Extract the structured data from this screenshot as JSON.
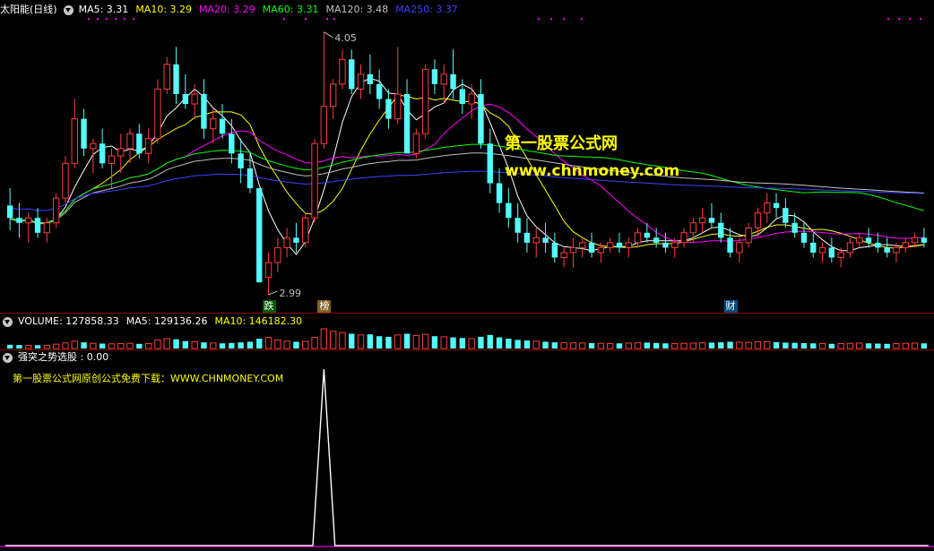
{
  "header_main": {
    "name": "太阳能(日线)",
    "ma5": "MA5: 3.31",
    "ma10": "MA10: 3.29",
    "ma20": "MA20: 3.29",
    "ma60": "MA60: 3.31",
    "ma120": "MA120: 3.48",
    "ma250": "MA250: 3.37"
  },
  "header_volume": {
    "volume": "VOLUME: 127858.33",
    "ma5": "MA5: 129136.26",
    "ma10": "MA10: 146182.30"
  },
  "header_indicator": {
    "name": "强突之势选股 : 0.00"
  },
  "watermark": {
    "line1": "第一股票公式网",
    "line2": "www.chnmoney.com"
  },
  "indicator_note": "第一股票公式网原创公式免费下载：WWW.CHNMONEY.COM",
  "price_labels": {
    "high": "4.05",
    "low": "2.99"
  },
  "signals": [
    {
      "text": "跌",
      "color": "#005a00",
      "index": 28
    },
    {
      "text": "榜",
      "color": "#806020",
      "index": 34
    },
    {
      "text": "财",
      "color": "#004a80",
      "index": 78
    }
  ],
  "colors": {
    "up": "#ff3c3c",
    "down": "#54fcfc",
    "ma5": "#ffffff",
    "ma10": "#ffff00",
    "ma20": "#ff00ff",
    "ma60": "#00ff00",
    "ma120": "#c0c0c0",
    "ma250": "#4040ff"
  },
  "chart_data": {
    "type": "candlestick",
    "price_range": [
      2.95,
      4.1
    ],
    "ohlc": [
      [
        3.35,
        3.42,
        3.25,
        3.3
      ],
      [
        3.3,
        3.36,
        3.22,
        3.28
      ],
      [
        3.28,
        3.32,
        3.2,
        3.3
      ],
      [
        3.3,
        3.34,
        3.22,
        3.24
      ],
      [
        3.24,
        3.3,
        3.2,
        3.28
      ],
      [
        3.28,
        3.4,
        3.26,
        3.38
      ],
      [
        3.38,
        3.55,
        3.36,
        3.52
      ],
      [
        3.52,
        3.78,
        3.5,
        3.7
      ],
      [
        3.7,
        3.74,
        3.55,
        3.58
      ],
      [
        3.58,
        3.62,
        3.48,
        3.6
      ],
      [
        3.6,
        3.66,
        3.5,
        3.52
      ],
      [
        3.52,
        3.58,
        3.42,
        3.55
      ],
      [
        3.55,
        3.64,
        3.48,
        3.58
      ],
      [
        3.58,
        3.66,
        3.52,
        3.64
      ],
      [
        3.64,
        3.68,
        3.54,
        3.56
      ],
      [
        3.56,
        3.66,
        3.52,
        3.62
      ],
      [
        3.62,
        3.86,
        3.6,
        3.82
      ],
      [
        3.82,
        3.95,
        3.8,
        3.92
      ],
      [
        3.92,
        3.99,
        3.76,
        3.8
      ],
      [
        3.8,
        3.88,
        3.74,
        3.76
      ],
      [
        3.76,
        3.84,
        3.7,
        3.8
      ],
      [
        3.8,
        3.86,
        3.62,
        3.66
      ],
      [
        3.66,
        3.74,
        3.6,
        3.7
      ],
      [
        3.7,
        3.76,
        3.62,
        3.64
      ],
      [
        3.64,
        3.7,
        3.52,
        3.56
      ],
      [
        3.56,
        3.62,
        3.44,
        3.5
      ],
      [
        3.5,
        3.56,
        3.4,
        3.42
      ],
      [
        3.42,
        3.42,
        3.05,
        3.04
      ],
      [
        3.06,
        3.16,
        2.99,
        3.12
      ],
      [
        3.12,
        3.22,
        3.08,
        3.18
      ],
      [
        3.18,
        3.26,
        3.14,
        3.22
      ],
      [
        3.22,
        3.28,
        3.16,
        3.2
      ],
      [
        3.2,
        3.32,
        3.18,
        3.3
      ],
      [
        3.3,
        3.62,
        3.28,
        3.6
      ],
      [
        3.6,
        4.05,
        3.58,
        3.75
      ],
      [
        3.75,
        3.86,
        3.7,
        3.84
      ],
      [
        3.84,
        3.98,
        3.82,
        3.94
      ],
      [
        3.94,
        3.98,
        3.8,
        3.82
      ],
      [
        3.82,
        3.92,
        3.78,
        3.88
      ],
      [
        3.88,
        3.96,
        3.8,
        3.84
      ],
      [
        3.84,
        3.9,
        3.74,
        3.78
      ],
      [
        3.78,
        3.82,
        3.66,
        3.7
      ],
      [
        3.7,
        3.99,
        3.68,
        3.8
      ],
      [
        3.8,
        3.86,
        3.6,
        3.56
      ],
      [
        3.56,
        3.66,
        3.54,
        3.64
      ],
      [
        3.64,
        3.92,
        3.62,
        3.9
      ],
      [
        3.9,
        3.94,
        3.8,
        3.84
      ],
      [
        3.84,
        3.92,
        3.76,
        3.88
      ],
      [
        3.88,
        3.98,
        3.78,
        3.82
      ],
      [
        3.82,
        3.86,
        3.72,
        3.76
      ],
      [
        3.76,
        3.84,
        3.7,
        3.8
      ],
      [
        3.8,
        3.86,
        3.58,
        3.6
      ],
      [
        3.6,
        3.66,
        3.4,
        3.44
      ],
      [
        3.44,
        3.5,
        3.32,
        3.36
      ],
      [
        3.36,
        3.42,
        3.26,
        3.3
      ],
      [
        3.3,
        3.36,
        3.2,
        3.24
      ],
      [
        3.24,
        3.3,
        3.16,
        3.2
      ],
      [
        3.2,
        3.26,
        3.14,
        3.22
      ],
      [
        3.22,
        3.28,
        3.16,
        3.2
      ],
      [
        3.2,
        3.24,
        3.12,
        3.14
      ],
      [
        3.14,
        3.18,
        3.1,
        3.16
      ],
      [
        3.16,
        3.22,
        3.1,
        3.18
      ],
      [
        3.18,
        3.22,
        3.14,
        3.2
      ],
      [
        3.2,
        3.24,
        3.14,
        3.16
      ],
      [
        3.16,
        3.2,
        3.12,
        3.18
      ],
      [
        3.18,
        3.22,
        3.16,
        3.2
      ],
      [
        3.2,
        3.24,
        3.16,
        3.18
      ],
      [
        3.18,
        3.22,
        3.14,
        3.2
      ],
      [
        3.2,
        3.26,
        3.18,
        3.24
      ],
      [
        3.24,
        3.28,
        3.2,
        3.22
      ],
      [
        3.22,
        3.26,
        3.18,
        3.2
      ],
      [
        3.2,
        3.24,
        3.16,
        3.18
      ],
      [
        3.18,
        3.22,
        3.14,
        3.2
      ],
      [
        3.2,
        3.26,
        3.18,
        3.24
      ],
      [
        3.24,
        3.3,
        3.2,
        3.28
      ],
      [
        3.28,
        3.34,
        3.24,
        3.3
      ],
      [
        3.3,
        3.36,
        3.26,
        3.28
      ],
      [
        3.28,
        3.32,
        3.2,
        3.22
      ],
      [
        3.22,
        3.26,
        3.14,
        3.16
      ],
      [
        3.16,
        3.22,
        3.12,
        3.2
      ],
      [
        3.2,
        3.28,
        3.18,
        3.26
      ],
      [
        3.26,
        3.34,
        3.22,
        3.32
      ],
      [
        3.32,
        3.4,
        3.28,
        3.36
      ],
      [
        3.36,
        3.4,
        3.3,
        3.34
      ],
      [
        3.34,
        3.38,
        3.26,
        3.28
      ],
      [
        3.28,
        3.32,
        3.22,
        3.24
      ],
      [
        3.24,
        3.28,
        3.18,
        3.2
      ],
      [
        3.2,
        3.24,
        3.14,
        3.16
      ],
      [
        3.16,
        3.2,
        3.12,
        3.18
      ],
      [
        3.18,
        3.22,
        3.12,
        3.14
      ],
      [
        3.14,
        3.18,
        3.1,
        3.16
      ],
      [
        3.16,
        3.22,
        3.14,
        3.2
      ],
      [
        3.2,
        3.24,
        3.18,
        3.22
      ],
      [
        3.22,
        3.26,
        3.18,
        3.2
      ],
      [
        3.2,
        3.24,
        3.16,
        3.18
      ],
      [
        3.18,
        3.22,
        3.14,
        3.16
      ],
      [
        3.16,
        3.2,
        3.12,
        3.18
      ],
      [
        3.18,
        3.22,
        3.16,
        3.2
      ],
      [
        3.2,
        3.24,
        3.18,
        3.22
      ],
      [
        3.22,
        3.26,
        3.18,
        3.2
      ]
    ],
    "volume": [
      30,
      28,
      25,
      27,
      26,
      35,
      45,
      60,
      50,
      42,
      40,
      38,
      40,
      42,
      38,
      40,
      70,
      80,
      75,
      60,
      55,
      50,
      45,
      42,
      45,
      50,
      55,
      80,
      90,
      70,
      60,
      55,
      58,
      90,
      160,
      140,
      130,
      120,
      110,
      115,
      100,
      95,
      110,
      120,
      105,
      115,
      100,
      95,
      90,
      85,
      80,
      95,
      110,
      90,
      80,
      70,
      65,
      60,
      55,
      50,
      48,
      46,
      45,
      44,
      42,
      40,
      42,
      44,
      46,
      48,
      45,
      42,
      40,
      42,
      44,
      46,
      48,
      50,
      55,
      52,
      50,
      54,
      56,
      52,
      48,
      46,
      44,
      42,
      40,
      38,
      40,
      42,
      44,
      42,
      40,
      38,
      40,
      42,
      44,
      42
    ],
    "indicator": {
      "peak_index": 34,
      "peak_value": 1,
      "base_value": 0,
      "ylim": [
        0,
        1
      ]
    }
  }
}
